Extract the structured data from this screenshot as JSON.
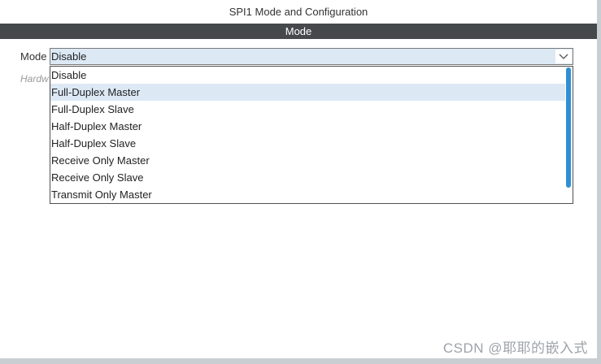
{
  "window": {
    "title": "SPI1 Mode and Configuration"
  },
  "section": {
    "header": "Mode"
  },
  "mode": {
    "label": "Mode",
    "selected_value": "Disable",
    "arrow_icon": "chevron-down-icon"
  },
  "hardware": {
    "label_visible": "Hardw"
  },
  "dropdown": {
    "items": [
      {
        "label": "Disable",
        "highlighted": false
      },
      {
        "label": "Full-Duplex Master",
        "highlighted": true
      },
      {
        "label": "Full-Duplex Slave",
        "highlighted": false
      },
      {
        "label": "Half-Duplex Master",
        "highlighted": false
      },
      {
        "label": "Half-Duplex Slave",
        "highlighted": false
      },
      {
        "label": "Receive Only Master",
        "highlighted": false
      },
      {
        "label": "Receive Only Slave",
        "highlighted": false
      },
      {
        "label": "Transmit Only Master",
        "highlighted": false
      }
    ],
    "highlight_color": "#dce9f5",
    "scrollbar_color": "#2f8fd3"
  },
  "watermark": {
    "text": "CSDN @耶耶的嵌入式"
  },
  "colors": {
    "header_bg": "#46494c",
    "select_bg": "#dce9f5"
  }
}
